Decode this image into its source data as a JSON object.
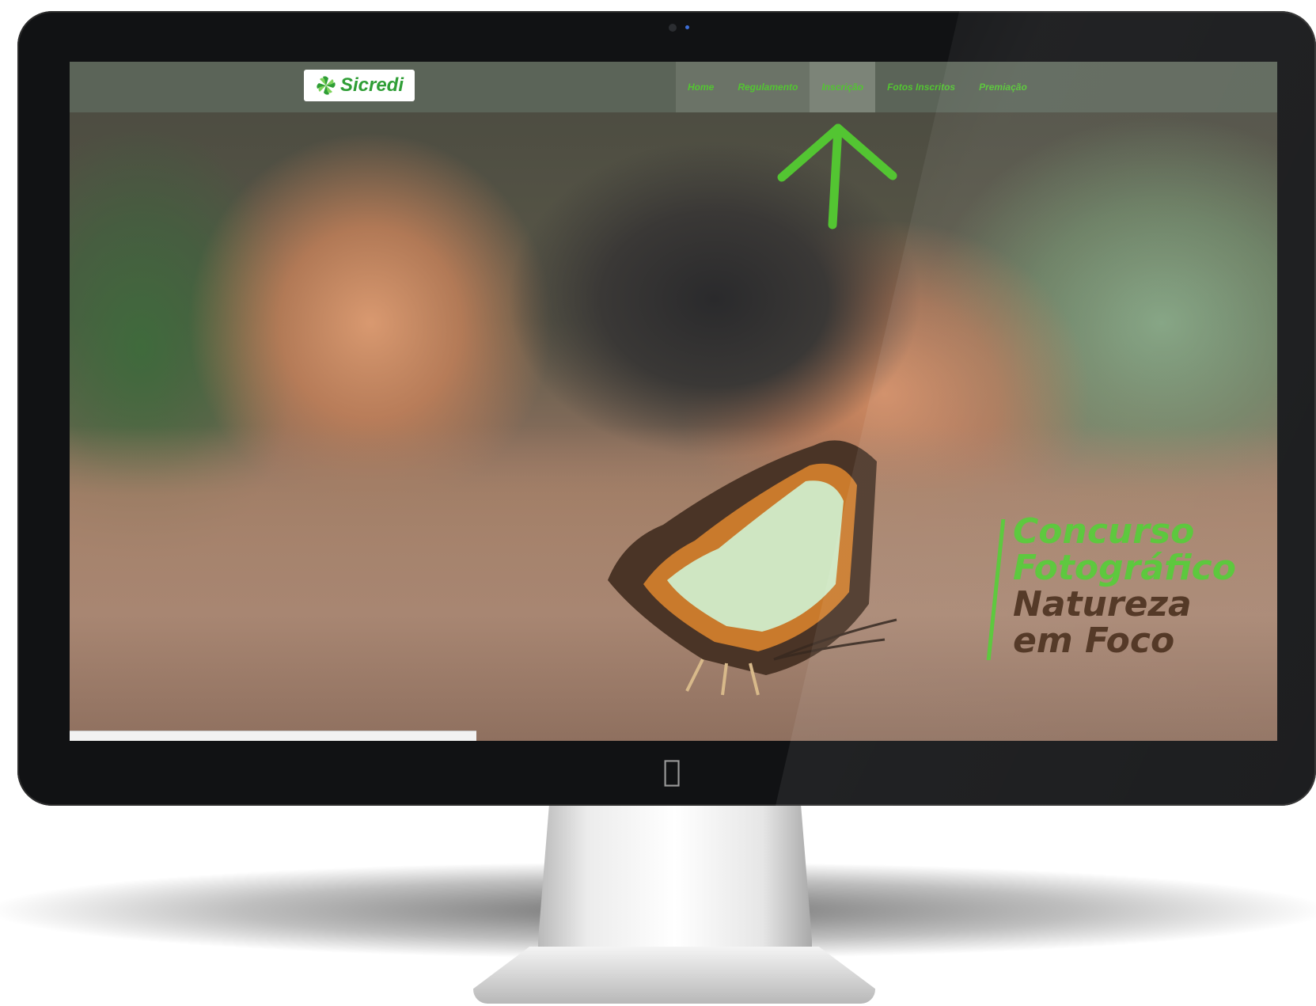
{
  "site": {
    "logo_text": "Sicredi",
    "brand_green": "#53c532"
  },
  "nav": {
    "items": [
      {
        "label": "Home"
      },
      {
        "label": "Regulamento"
      },
      {
        "label": "Inscrição"
      },
      {
        "label": "Fotos Inscritos"
      },
      {
        "label": "Premiação"
      }
    ],
    "active_index": 2
  },
  "hero": {
    "line1": "Concurso",
    "line2": "Fotográfico",
    "line3": "Natureza",
    "line4": "em Foco",
    "accent_color": "#53c532",
    "dark_color": "#4a2d1a"
  },
  "device": {
    "logo_icon": "apple-icon"
  }
}
